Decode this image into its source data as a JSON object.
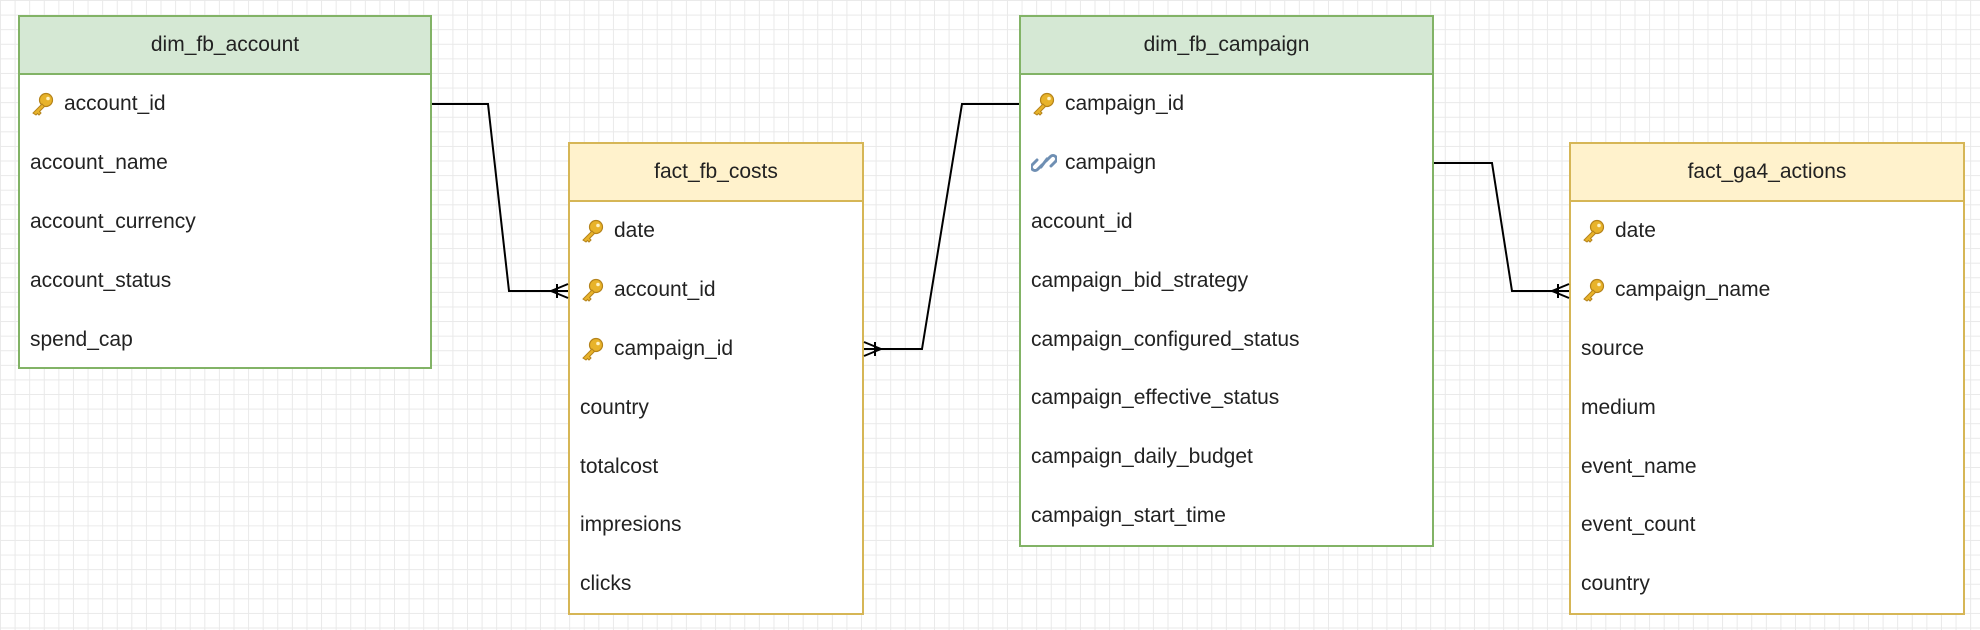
{
  "tables": {
    "dim_fb_account": {
      "title": "dim_fb_account",
      "fields": [
        {
          "name": "account_id",
          "icon": "key-icon"
        },
        {
          "name": "account_name",
          "icon": ""
        },
        {
          "name": "account_currency",
          "icon": ""
        },
        {
          "name": "account_status",
          "icon": ""
        },
        {
          "name": "spend_cap",
          "icon": ""
        }
      ]
    },
    "fact_fb_costs": {
      "title": "fact_fb_costs",
      "fields": [
        {
          "name": "date",
          "icon": "key-icon"
        },
        {
          "name": "account_id",
          "icon": "key-icon"
        },
        {
          "name": "campaign_id",
          "icon": "key-icon"
        },
        {
          "name": "country",
          "icon": ""
        },
        {
          "name": "totalcost",
          "icon": ""
        },
        {
          "name": "impresions",
          "icon": ""
        },
        {
          "name": "clicks",
          "icon": ""
        }
      ]
    },
    "dim_fb_campaign": {
      "title": "dim_fb_campaign",
      "fields": [
        {
          "name": "campaign_id",
          "icon": "key-icon"
        },
        {
          "name": "campaign",
          "icon": "link-icon"
        },
        {
          "name": "account_id",
          "icon": ""
        },
        {
          "name": "campaign_bid_strategy",
          "icon": ""
        },
        {
          "name": "campaign_configured_status",
          "icon": ""
        },
        {
          "name": "campaign_effective_status",
          "icon": ""
        },
        {
          "name": "campaign_daily_budget",
          "icon": ""
        },
        {
          "name": "campaign_start_time",
          "icon": ""
        }
      ]
    },
    "fact_ga4_actions": {
      "title": "fact_ga4_actions",
      "fields": [
        {
          "name": "date",
          "icon": "key-icon"
        },
        {
          "name": "campaign_name",
          "icon": "key-icon"
        },
        {
          "name": "source",
          "icon": ""
        },
        {
          "name": "medium",
          "icon": ""
        },
        {
          "name": "event_name",
          "icon": ""
        },
        {
          "name": "event_count",
          "icon": ""
        },
        {
          "name": "country",
          "icon": ""
        }
      ]
    }
  },
  "relationships": [
    {
      "from": "dim_fb_account.account_id",
      "to": "fact_fb_costs.account_id",
      "cardinality": "one-to-many"
    },
    {
      "from": "dim_fb_campaign.campaign_id",
      "to": "fact_fb_costs.campaign_id",
      "cardinality": "one-to-many"
    },
    {
      "from": "dim_fb_campaign.campaign",
      "to": "fact_ga4_actions.campaign_name",
      "cardinality": "one-to-many"
    }
  ],
  "colors": {
    "dim_header_fill": "#d5e8d4",
    "dim_border": "#82b366",
    "fact_header_fill": "#fff2cc",
    "fact_border": "#d6b656",
    "grid": "#e9e9e9"
  }
}
